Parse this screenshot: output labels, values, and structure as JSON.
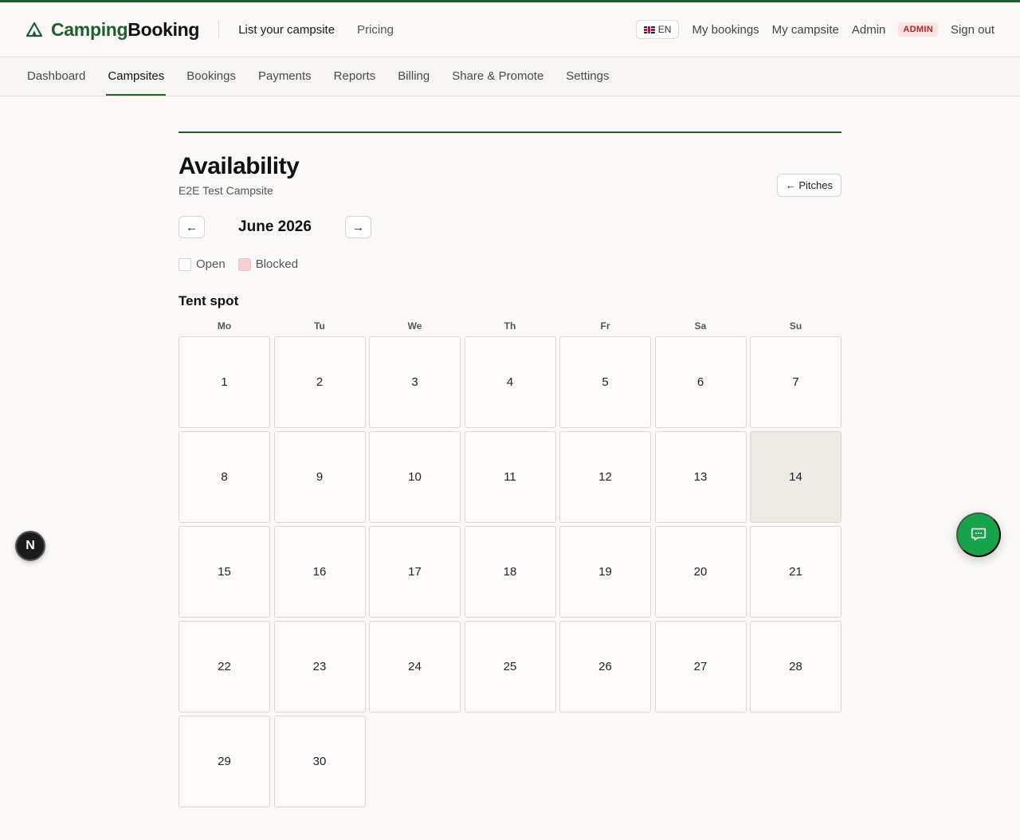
{
  "brand": {
    "part1": "Camping",
    "part2": "Booking",
    "logo_icon": "tent-icon"
  },
  "top_links": [
    {
      "label": "List your campsite"
    },
    {
      "label": "Pricing"
    }
  ],
  "right_nav": {
    "language": "EN",
    "my_bookings": "My bookings",
    "my_campsite": "My campsite",
    "admin": "Admin",
    "admin_badge": "ADMIN",
    "sign_out": "Sign out"
  },
  "subnav": [
    {
      "label": "Dashboard",
      "active": false
    },
    {
      "label": "Campsites",
      "active": true
    },
    {
      "label": "Bookings",
      "active": false
    },
    {
      "label": "Payments",
      "active": false
    },
    {
      "label": "Reports",
      "active": false
    },
    {
      "label": "Billing",
      "active": false
    },
    {
      "label": "Share & Promote",
      "active": false
    },
    {
      "label": "Settings",
      "active": false
    }
  ],
  "page": {
    "title": "Availability",
    "subtitle": "E2E Test Campsite",
    "back_button": "← Pitches",
    "prev_arrow": "←",
    "next_arrow": "→",
    "month": "June 2026"
  },
  "legend": {
    "open": "Open",
    "blocked": "Blocked"
  },
  "pitch": {
    "name": "Tent spot",
    "weekdays": [
      "Mo",
      "Tu",
      "We",
      "Th",
      "Fr",
      "Sa",
      "Su"
    ],
    "days": [
      "1",
      "2",
      "3",
      "4",
      "5",
      "6",
      "7",
      "8",
      "9",
      "10",
      "11",
      "12",
      "13",
      "14",
      "15",
      "16",
      "17",
      "18",
      "19",
      "20",
      "21",
      "22",
      "23",
      "24",
      "25",
      "26",
      "27",
      "28",
      "29",
      "30"
    ],
    "highlighted_day": "14"
  },
  "floating": {
    "n_badge": "N"
  },
  "colors": {
    "brand_green": "#1f5f2f",
    "chat_green": "#16a34a",
    "admin_red": "#b3261e"
  }
}
